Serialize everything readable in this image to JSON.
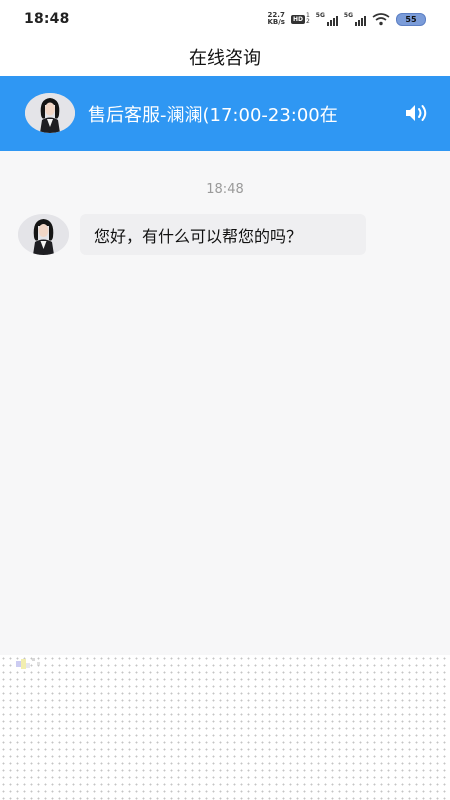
{
  "status_bar": {
    "time": "18:48",
    "net_speed_value": "22.7",
    "net_speed_unit": "KB/s",
    "hd_label": "HD",
    "hd_sub_top": "1",
    "hd_sub_bottom": "2",
    "sig1_label": "5G",
    "sig2_label": "5G",
    "battery": "55"
  },
  "header": {
    "title": "在线咨询"
  },
  "agent_banner": {
    "name": "售后客服-澜澜(17:00-23:00在",
    "background": "#2f97f3",
    "speaker_icon": "speaker-icon"
  },
  "chat": {
    "timestamp": "18:48",
    "messages": [
      {
        "sender": "agent",
        "text": "您好，有什么可以帮您的吗？"
      }
    ]
  }
}
